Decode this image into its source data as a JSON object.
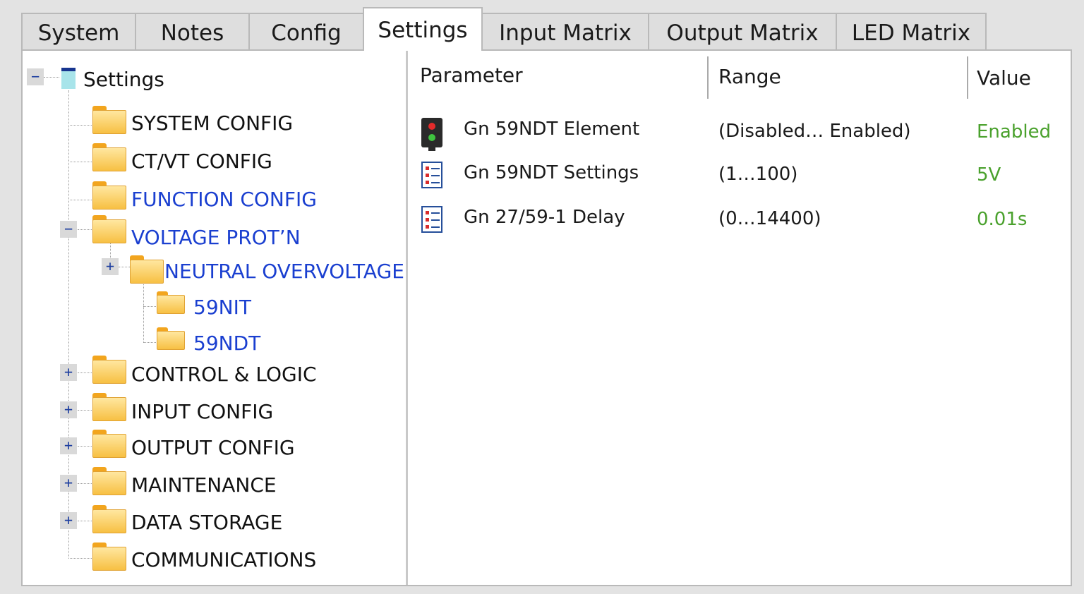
{
  "tabs": [
    "System",
    "Notes",
    "Config",
    "Settings",
    "Input Matrix",
    "Output Matrix",
    "LED Matrix"
  ],
  "active_tab": "Settings",
  "tree": {
    "root": {
      "label": "Settings",
      "expander": "−"
    },
    "items": [
      {
        "label": "SYSTEM CONFIG",
        "color": "#111111"
      },
      {
        "label": "CT/VT CONFIG",
        "color": "#111111"
      },
      {
        "label": "FUNCTION CONFIG",
        "color": "#1a3fd0"
      },
      {
        "label": "VOLTAGE PROT’N",
        "color": "#1a3fd0",
        "expander": "−"
      },
      {
        "label": "NEUTRAL OVERVOLTAGE",
        "color": "#1a3fd0",
        "expander": "+"
      },
      {
        "label": "59NIT",
        "color": "#1a3fd0"
      },
      {
        "label": "59NDT",
        "color": "#1a3fd0"
      },
      {
        "label": "CONTROL & LOGIC",
        "color": "#111111",
        "expander": "+"
      },
      {
        "label": "INPUT CONFIG",
        "color": "#111111",
        "expander": "+"
      },
      {
        "label": "OUTPUT CONFIG",
        "color": "#111111",
        "expander": "+"
      },
      {
        "label": "MAINTENANCE",
        "color": "#111111",
        "expander": "+"
      },
      {
        "label": "DATA STORAGE",
        "color": "#111111",
        "expander": "+"
      },
      {
        "label": "COMMUNICATIONS",
        "color": "#111111"
      }
    ]
  },
  "table": {
    "headers": {
      "parameter": "Parameter",
      "range": "Range",
      "value": "Value"
    },
    "rows": [
      {
        "icon": "toggle-icon",
        "parameter": "Gn 59NDT Element",
        "range": "(Disabled… Enabled)",
        "value": "Enabled"
      },
      {
        "icon": "list-settings-icon",
        "parameter": "Gn 59NDT Settings",
        "range": "(1…100)",
        "value": "5V"
      },
      {
        "icon": "list-settings-icon",
        "parameter": "Gn 27/59-1 Delay",
        "range": "(0…14400)",
        "value": "0.01s"
      }
    ],
    "value_color": "#4aa12d"
  }
}
